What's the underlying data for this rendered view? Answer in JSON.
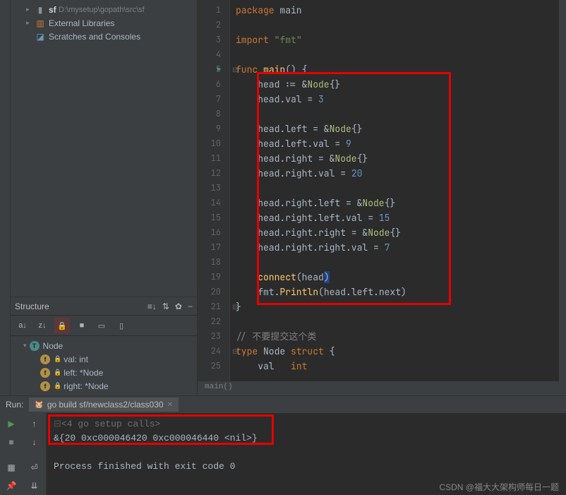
{
  "project": {
    "root_name": "sf",
    "root_path": "D:\\mysetup\\gopath\\src\\sf",
    "external_libs": "External Libraries",
    "scratches": "Scratches and Consoles"
  },
  "structure": {
    "title": "Structure",
    "node": "Node",
    "fields": [
      {
        "name": "val: int"
      },
      {
        "name": "left: *Node"
      },
      {
        "name": "right: *Node"
      }
    ]
  },
  "gutter": [
    "1",
    "2",
    "3",
    "4",
    "5",
    "6",
    "7",
    "8",
    "9",
    "10",
    "11",
    "12",
    "13",
    "14",
    "15",
    "16",
    "17",
    "18",
    "19",
    "20",
    "21",
    "22",
    "23",
    "24",
    "25"
  ],
  "code": {
    "l1a": "package",
    "l1b": " main",
    "l3a": "import",
    "l3b": " \"fmt\"",
    "l5a": "func",
    "l5b": " ",
    "l5c": "main",
    "l5d": "() {",
    "l6a": "    head := &",
    "l6b": "Node",
    "l6c": "{}",
    "l7a": "    head.val = ",
    "l7b": "3",
    "l9a": "    head.left = &",
    "l9b": "Node",
    "l9c": "{}",
    "l10a": "    head.left.val = ",
    "l10b": "9",
    "l11a": "    head.right = &",
    "l11b": "Node",
    "l11c": "{}",
    "l12a": "    head.right.val = ",
    "l12b": "20",
    "l14a": "    head.right.left = &",
    "l14b": "Node",
    "l14c": "{}",
    "l15a": "    head.right.left.val = ",
    "l15b": "15",
    "l16a": "    head.right.right = &",
    "l16b": "Node",
    "l16c": "{}",
    "l17a": "    head.right.right.val = ",
    "l17b": "7",
    "l19a": "    ",
    "l19b": "connect",
    "l19c": "(head",
    "l19d": ")",
    "l20a": "    fmt.",
    "l20b": "Println",
    "l20c": "(head.left.next)",
    "l21": "}",
    "l23": "// 不要提交这个类",
    "l24a": "type",
    "l24b": " Node ",
    "l24c": "struct",
    "l24d": " {",
    "l25a": "    val   ",
    "l25b": "int"
  },
  "breadcrumb": "main()",
  "run": {
    "label": "Run:",
    "tab": "go build sf/newclass2/class030",
    "out1": "<4 go setup calls>",
    "out2": "&{20 0xc000046420 0xc000046440 <nil>}",
    "out3": "Process finished with exit code 0"
  },
  "watermark": "CSDN @福大大架构师每日一题"
}
